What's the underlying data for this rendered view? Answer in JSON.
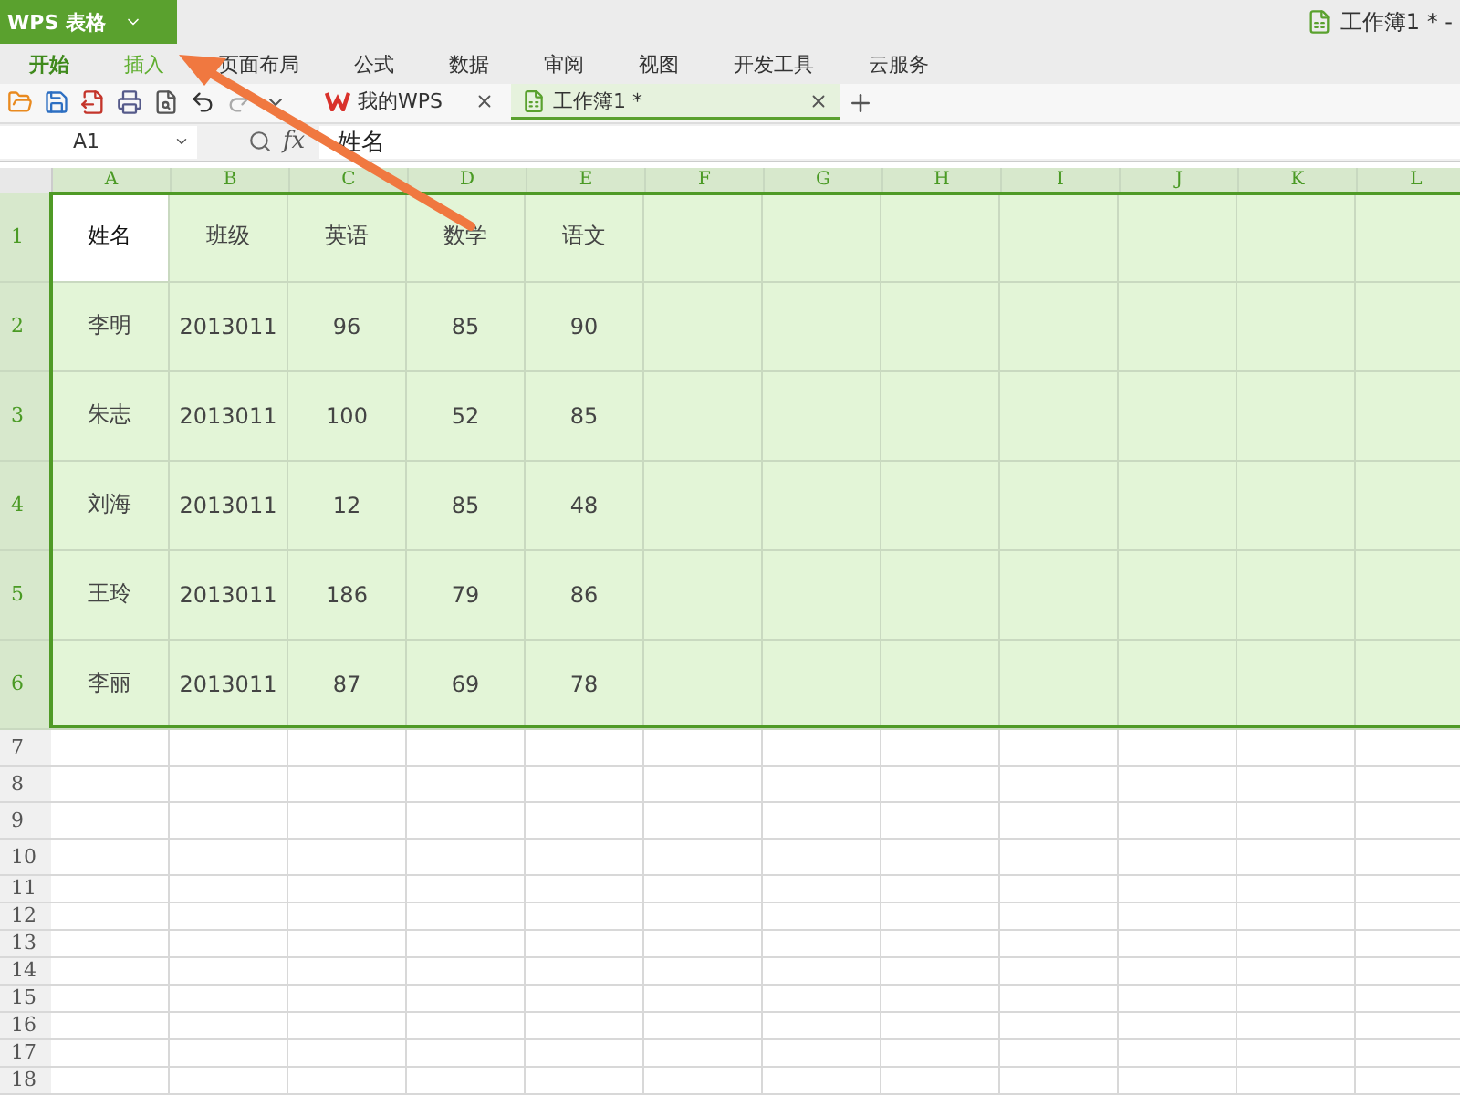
{
  "app_button": {
    "label": "WPS 表格"
  },
  "window_title": "工作簿1 * -",
  "menu_tabs": [
    {
      "label": "开始",
      "selected": true,
      "highlighted": false
    },
    {
      "label": "插入",
      "selected": false,
      "highlighted": true
    },
    {
      "label": "页面布局",
      "selected": false,
      "highlighted": false
    },
    {
      "label": "公式",
      "selected": false,
      "highlighted": false
    },
    {
      "label": "数据",
      "selected": false,
      "highlighted": false
    },
    {
      "label": "审阅",
      "selected": false,
      "highlighted": false
    },
    {
      "label": "视图",
      "selected": false,
      "highlighted": false
    },
    {
      "label": "开发工具",
      "selected": false,
      "highlighted": false
    },
    {
      "label": "云服务",
      "selected": false,
      "highlighted": false
    }
  ],
  "doc_tabs": [
    {
      "label": "我的WPS",
      "kind": "home",
      "selected": false
    },
    {
      "label": "工作簿1 *",
      "kind": "sheet",
      "selected": true
    }
  ],
  "name_box": {
    "value": "A1"
  },
  "formula_bar": {
    "fx_label": "fx",
    "value": "姓名"
  },
  "columns": [
    {
      "label": "A",
      "selected": true
    },
    {
      "label": "B",
      "selected": true
    },
    {
      "label": "C",
      "selected": true
    },
    {
      "label": "D",
      "selected": true
    },
    {
      "label": "E",
      "selected": true
    },
    {
      "label": "F",
      "selected": true
    },
    {
      "label": "G",
      "selected": true
    },
    {
      "label": "H",
      "selected": true
    },
    {
      "label": "I",
      "selected": true
    },
    {
      "label": "J",
      "selected": true
    },
    {
      "label": "K",
      "selected": true
    },
    {
      "label": "L",
      "selected": true
    }
  ],
  "rows": [
    {
      "number": "1",
      "selected": true,
      "cells": [
        {
          "text": "姓名",
          "active": true
        },
        {
          "text": "班级",
          "active": false
        },
        {
          "text": "英语",
          "active": false
        },
        {
          "text": "数学",
          "active": false
        },
        {
          "text": "语文",
          "active": false
        }
      ]
    },
    {
      "number": "2",
      "selected": true,
      "cells": [
        {
          "text": "李明",
          "active": false
        },
        {
          "text": "2013011",
          "active": false
        },
        {
          "text": "96",
          "active": false
        },
        {
          "text": "85",
          "active": false
        },
        {
          "text": "90",
          "active": false
        }
      ]
    },
    {
      "number": "3",
      "selected": true,
      "cells": [
        {
          "text": "朱志",
          "active": false
        },
        {
          "text": "2013011",
          "active": false
        },
        {
          "text": "100",
          "active": false
        },
        {
          "text": "52",
          "active": false
        },
        {
          "text": "85",
          "active": false
        }
      ]
    },
    {
      "number": "4",
      "selected": true,
      "cells": [
        {
          "text": "刘海",
          "active": false
        },
        {
          "text": "2013011",
          "active": false
        },
        {
          "text": "12",
          "active": false
        },
        {
          "text": "85",
          "active": false
        },
        {
          "text": "48",
          "active": false
        }
      ]
    },
    {
      "number": "5",
      "selected": true,
      "cells": [
        {
          "text": "王玲",
          "active": false
        },
        {
          "text": "2013011",
          "active": false
        },
        {
          "text": "186",
          "active": false
        },
        {
          "text": "79",
          "active": false
        },
        {
          "text": "86",
          "active": false
        }
      ]
    },
    {
      "number": "6",
      "selected": true,
      "cells": [
        {
          "text": "李丽",
          "active": false
        },
        {
          "text": "2013011",
          "active": false
        },
        {
          "text": "87",
          "active": false
        },
        {
          "text": "69",
          "active": false
        },
        {
          "text": "78",
          "active": false
        }
      ]
    },
    {
      "number": "7",
      "selected": false,
      "cells": []
    },
    {
      "number": "8",
      "selected": false,
      "cells": []
    },
    {
      "number": "9",
      "selected": false,
      "cells": []
    },
    {
      "number": "10",
      "selected": false,
      "cells": []
    },
    {
      "number": "11",
      "selected": false,
      "cells": []
    },
    {
      "number": "12",
      "selected": false,
      "cells": []
    },
    {
      "number": "13",
      "selected": false,
      "cells": []
    },
    {
      "number": "14",
      "selected": false,
      "cells": []
    },
    {
      "number": "15",
      "selected": false,
      "cells": []
    },
    {
      "number": "16",
      "selected": false,
      "cells": []
    },
    {
      "number": "17",
      "selected": false,
      "cells": []
    },
    {
      "number": "18",
      "selected": false,
      "cells": []
    }
  ]
}
